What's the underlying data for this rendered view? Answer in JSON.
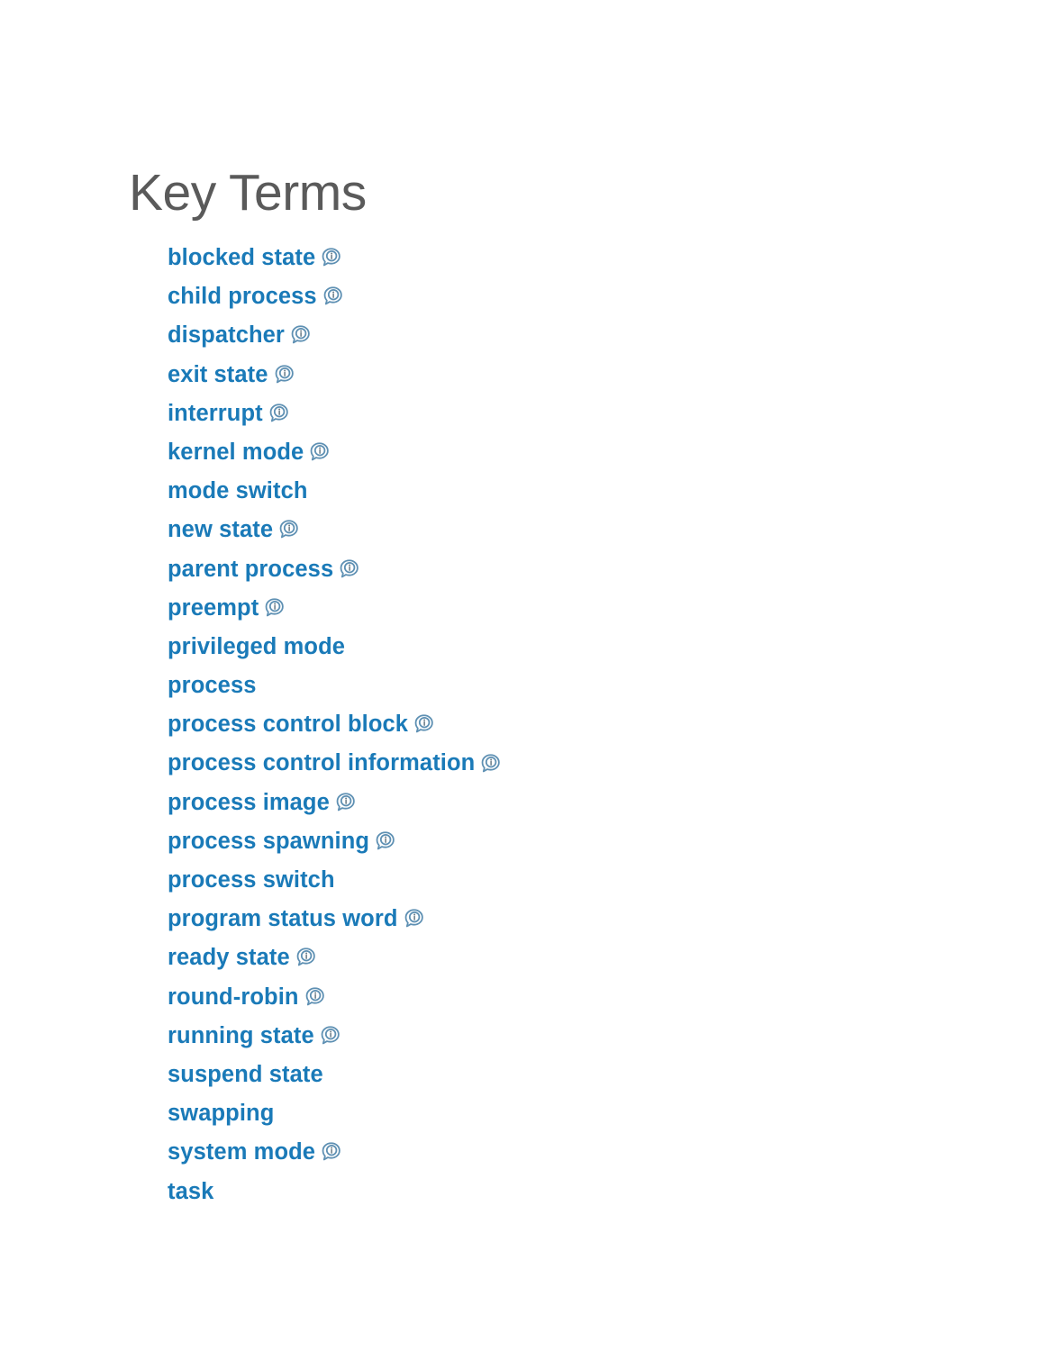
{
  "page": {
    "background_color": "#ffffff",
    "title": "Key Terms",
    "title_color": "#5a5a5a",
    "term_color": "#1a7ab8",
    "icon_color": "#5e90b3"
  },
  "icons": {
    "info_bubble": "info-comment-bubble-icon"
  },
  "terms": [
    {
      "label": "blocked state",
      "has_icon": true
    },
    {
      "label": "child process",
      "has_icon": true
    },
    {
      "label": "dispatcher",
      "has_icon": true
    },
    {
      "label": "exit state",
      "has_icon": true
    },
    {
      "label": "interrupt",
      "has_icon": true
    },
    {
      "label": "kernel mode",
      "has_icon": true
    },
    {
      "label": "mode switch",
      "has_icon": false
    },
    {
      "label": "new state",
      "has_icon": true
    },
    {
      "label": "parent process",
      "has_icon": true
    },
    {
      "label": "preempt",
      "has_icon": true
    },
    {
      "label": "privileged mode",
      "has_icon": false
    },
    {
      "label": "process",
      "has_icon": false
    },
    {
      "label": "process control block",
      "has_icon": true
    },
    {
      "label": "process control information",
      "has_icon": true
    },
    {
      "label": "process image",
      "has_icon": true
    },
    {
      "label": "process spawning",
      "has_icon": true
    },
    {
      "label": "process switch",
      "has_icon": false
    },
    {
      "label": "program status word",
      "has_icon": true
    },
    {
      "label": "ready state",
      "has_icon": true
    },
    {
      "label": "round-robin",
      "has_icon": true
    },
    {
      "label": "running state",
      "has_icon": true
    },
    {
      "label": "suspend state",
      "has_icon": false
    },
    {
      "label": "swapping",
      "has_icon": false
    },
    {
      "label": "system mode",
      "has_icon": true
    },
    {
      "label": "task",
      "has_icon": false
    }
  ]
}
